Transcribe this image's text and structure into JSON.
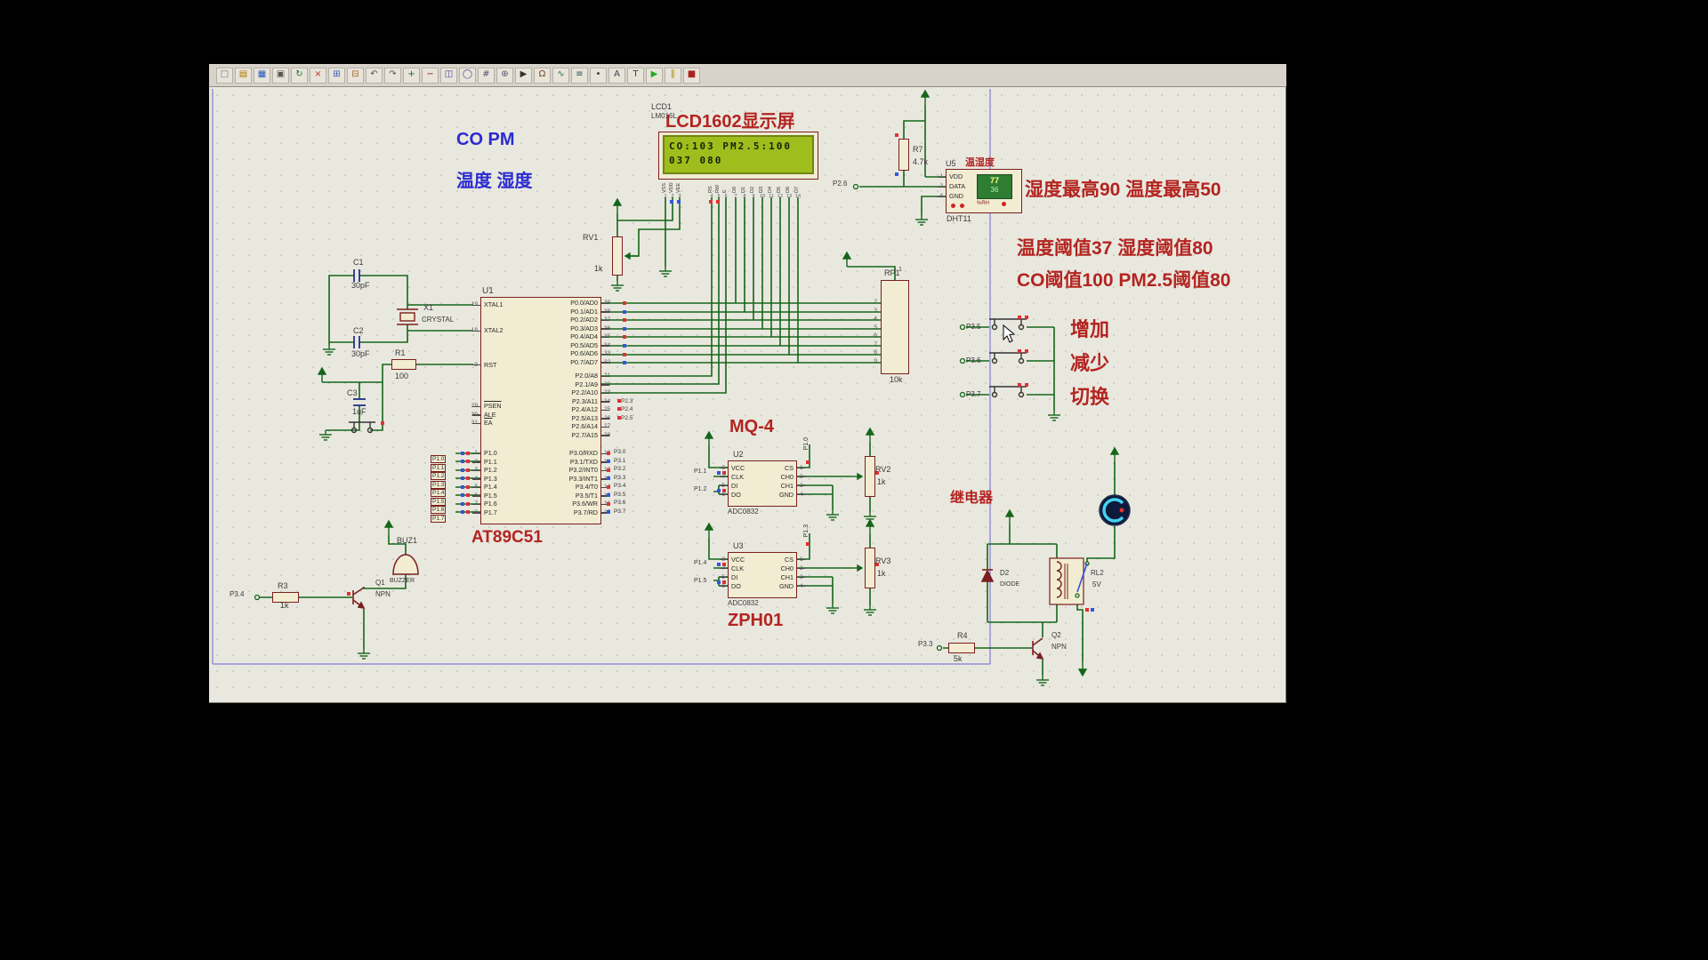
{
  "colors": {
    "wire_green": "#15651a",
    "component_outline": "#7a1f1f",
    "annotation_red": "#b32420",
    "annotation_blue": "#2b2bd0",
    "state_high_red": "#e03131",
    "state_low_blue": "#3156e0",
    "sheet_border_blue": "#5050d0",
    "lcd_screen_green": "#9fbd1c"
  },
  "toolbar": {
    "icons": [
      {
        "n": "new-sheet",
        "g": "□",
        "c": "#667788"
      },
      {
        "n": "open",
        "g": "▤",
        "c": "#aa7700"
      },
      {
        "n": "save",
        "g": "▦",
        "c": "#2255bb"
      },
      {
        "n": "print",
        "g": "▣",
        "c": "#555555"
      },
      {
        "n": "refresh",
        "g": "↻",
        "c": "#227733"
      },
      {
        "n": "cut",
        "g": "×",
        "c": "#bb3333"
      },
      {
        "n": "copy",
        "g": "⊞",
        "c": "#3355bb"
      },
      {
        "n": "paste",
        "g": "⊟",
        "c": "#996622"
      },
      {
        "n": "undo",
        "g": "↶",
        "c": "#555555"
      },
      {
        "n": "redo",
        "g": "↷",
        "c": "#555555"
      },
      {
        "n": "zoom-in",
        "g": "+",
        "c": "#226622"
      },
      {
        "n": "zoom-out",
        "g": "−",
        "c": "#882222"
      },
      {
        "n": "zoom-area",
        "g": "◫",
        "c": "#444499"
      },
      {
        "n": "zoom-all",
        "g": "◯",
        "c": "#444499"
      },
      {
        "n": "grid",
        "g": "#",
        "c": "#555577"
      },
      {
        "n": "origin",
        "g": "⊕",
        "c": "#555577"
      },
      {
        "n": "selection-cursor",
        "g": "▶",
        "c": "#333333"
      },
      {
        "n": "component-mode",
        "g": "Ω",
        "c": "#774422"
      },
      {
        "n": "wire-mode",
        "g": "∿",
        "c": "#227733"
      },
      {
        "n": "bus-mode",
        "g": "≡",
        "c": "#225555"
      },
      {
        "n": "junction",
        "g": "•",
        "c": "#333333"
      },
      {
        "n": "label",
        "g": "A",
        "c": "#334455"
      },
      {
        "n": "text",
        "g": "T",
        "c": "#334455"
      },
      {
        "n": "play",
        "g": "▶",
        "c": "#22aa22"
      },
      {
        "n": "pause",
        "g": "∥",
        "c": "#aa8800"
      },
      {
        "n": "stop",
        "g": "■",
        "c": "#aa2222"
      }
    ]
  },
  "annotations": {
    "co_pm": "CO PM",
    "temp_hum": "温度 湿度",
    "lcd_title": "LCD1602显示屏",
    "limits1": "湿度最高90 温度最高50",
    "limits2": "温度阈值37 湿度阈值80",
    "limits3": "CO阈值100 PM2.5阈值80",
    "mq4": "MQ-4",
    "zph01": "ZPH01",
    "relay": "继电器",
    "dht_label": "温湿度"
  },
  "lcd": {
    "ref": "LCD1",
    "model": "LM016L",
    "line1": "CO:103 PM2.5:100",
    "line2": "037 080",
    "pins_power": [
      {
        "name": "VSS",
        "num": "1"
      },
      {
        "name": "VDD",
        "num": "2"
      },
      {
        "name": "VEE",
        "num": "3"
      }
    ],
    "pins_ctrl": [
      {
        "name": "RS",
        "num": "4"
      },
      {
        "name": "RW",
        "num": "5"
      },
      {
        "name": "E",
        "num": "6"
      }
    ],
    "pins_data": [
      {
        "name": "D0",
        "num": "7"
      },
      {
        "name": "D1",
        "num": "8"
      },
      {
        "name": "D2",
        "num": "9"
      },
      {
        "name": "D3",
        "num": "10"
      },
      {
        "name": "D4",
        "num": "11"
      },
      {
        "name": "D5",
        "num": "12"
      },
      {
        "name": "D6",
        "num": "13"
      },
      {
        "name": "D7",
        "num": "14"
      }
    ]
  },
  "mcu": {
    "ref": "U1",
    "name": "AT89C51",
    "xtal": [
      {
        "name": "XTAL1",
        "num": "19"
      },
      {
        "name": "XTAL2",
        "num": "18"
      }
    ],
    "rst": [
      {
        "name": "RST",
        "num": "9"
      }
    ],
    "ctrl": [
      {
        "name": "PSEN",
        "num": "29",
        "state": "ov"
      },
      {
        "name": "ALE",
        "num": "30"
      },
      {
        "name": "EA",
        "num": "31",
        "state": "ov"
      }
    ],
    "p1": [
      {
        "name": "P1.0",
        "num": "1"
      },
      {
        "name": "P1.1",
        "num": "2"
      },
      {
        "name": "P1.2",
        "num": "3"
      },
      {
        "name": "P1.3",
        "num": "4"
      },
      {
        "name": "P1.4",
        "num": "5"
      },
      {
        "name": "P1.5",
        "num": "6"
      },
      {
        "name": "P1.6",
        "num": "7"
      },
      {
        "name": "P1.7",
        "num": "8"
      }
    ],
    "p0": [
      {
        "name": "P0.0/AD0",
        "num": "39"
      },
      {
        "name": "P0.1/AD1",
        "num": "38"
      },
      {
        "name": "P0.2/AD2",
        "num": "37"
      },
      {
        "name": "P0.3/AD3",
        "num": "36"
      },
      {
        "name": "P0.4/AD4",
        "num": "35"
      },
      {
        "name": "P0.5/AD5",
        "num": "34"
      },
      {
        "name": "P0.6/AD6",
        "num": "33"
      },
      {
        "name": "P0.7/AD7",
        "num": "32"
      }
    ],
    "p2": [
      {
        "name": "P2.0/A8",
        "num": "21"
      },
      {
        "name": "P2.1/A9",
        "num": "22"
      },
      {
        "name": "P2.2/A10",
        "num": "23"
      },
      {
        "name": "P2.3/A11",
        "num": "24"
      },
      {
        "name": "P2.4/A12",
        "num": "25"
      },
      {
        "name": "P2.5/A13",
        "num": "26"
      },
      {
        "name": "P2.6/A14",
        "num": "27"
      },
      {
        "name": "P2.7/A15",
        "num": "28"
      }
    ],
    "p3": [
      {
        "name": "P3.0/RXD",
        "num": "10"
      },
      {
        "name": "P3.1/TXD",
        "num": "11"
      },
      {
        "name": "P3.2/INT0",
        "num": "12"
      },
      {
        "name": "P3.3/INT1",
        "num": "13"
      },
      {
        "name": "P3.4/T0",
        "num": "14"
      },
      {
        "name": "P3.5/T1",
        "num": "15"
      },
      {
        "name": "P3.6/WR",
        "num": "16"
      },
      {
        "name": "P3.7/RD",
        "num": "17"
      }
    ]
  },
  "adc": {
    "left": [
      {
        "name": "VCC",
        "num": "8"
      },
      {
        "name": "CLK",
        "num": "7"
      },
      {
        "name": "DI",
        "num": "5"
      },
      {
        "name": "DO",
        "num": "6"
      }
    ],
    "right": [
      {
        "name": "CS",
        "num": "1"
      },
      {
        "name": "CH0",
        "num": "2"
      },
      {
        "name": "CH1",
        "num": "3"
      },
      {
        "name": "GND",
        "num": "4"
      }
    ]
  },
  "dht": {
    "pins": [
      {
        "name": "VDD",
        "num": "1"
      },
      {
        "name": "DATA",
        "num": "2"
      },
      {
        "name": "GND",
        "num": "4"
      }
    ],
    "display_top": "77",
    "display_bottom": "36",
    "rh": "%RH"
  },
  "rp1_pins": [
    "2",
    "3",
    "4",
    "5",
    "6",
    "7",
    "8",
    "9"
  ],
  "parts": {
    "c1": {
      "ref": "C1",
      "val": "30pF"
    },
    "c2": {
      "ref": "C2",
      "val": "30pF"
    },
    "c3": {
      "ref": "C3",
      "val": "1uF"
    },
    "x1": {
      "ref": "X1",
      "val": "CRYSTAL"
    },
    "r1": {
      "ref": "R1",
      "val": "100"
    },
    "r3": {
      "ref": "R3",
      "val": "1k"
    },
    "r4": {
      "ref": "R4",
      "val": "5k"
    },
    "r7": {
      "ref": "R7",
      "val": "4.7k"
    },
    "rv1": {
      "ref": "RV1",
      "val": "1k"
    },
    "rv2": {
      "ref": "RV2",
      "val": "1k"
    },
    "rv3": {
      "ref": "RV3",
      "val": "1k"
    },
    "rp1": {
      "ref": "RP1",
      "val": "10k",
      "pin1": "1"
    },
    "u2": {
      "ref": "U2",
      "val": "ADC0832"
    },
    "u3": {
      "ref": "U3",
      "val": "ADC0832"
    },
    "u5": {
      "ref": "U5",
      "val": "DHT11"
    },
    "buz1": {
      "ref": "BUZ1",
      "val": "BUZZER"
    },
    "q1": {
      "ref": "Q1",
      "val": "NPN"
    },
    "q2": {
      "ref": "Q2",
      "val": "NPN"
    },
    "d2": {
      "ref": "D2",
      "val": "DIODE"
    },
    "rl2": {
      "ref": "RL2",
      "val": "5V"
    }
  },
  "nets": {
    "p26": "P2.6",
    "p34": "P3.4",
    "p33": "P3.3",
    "p10": "P1.0",
    "p11": "P1.1",
    "p12": "P1.2",
    "p13": "P1.3",
    "p14": "P1.4",
    "p15": "P1.5",
    "p23": "P2.3",
    "p24": "P2.4",
    "p25": "P2.5"
  },
  "net_p1": [
    {
      "label": "P1.0"
    },
    {
      "label": "P1.1"
    },
    {
      "label": "P1.2"
    },
    {
      "label": "P1.3"
    },
    {
      "label": "P1.4"
    },
    {
      "label": "P1.5"
    },
    {
      "label": "P1.6"
    },
    {
      "label": "P1.7"
    }
  ],
  "net_p3": [
    {
      "label": "P3.0",
      "state": "r"
    },
    {
      "label": "P3.1",
      "state": "b"
    },
    {
      "label": "P3.2",
      "state": "r"
    },
    {
      "label": "P3.3",
      "state": "b"
    },
    {
      "label": "P3.4",
      "state": "r"
    },
    {
      "label": "P3.5",
      "state": "b"
    },
    {
      "label": "P3.6",
      "state": "r"
    },
    {
      "label": "P3.7",
      "state": "b"
    }
  ],
  "buttons": [
    {
      "net": "P3.5",
      "label": "增加"
    },
    {
      "net": "P3.6",
      "label": "减少"
    },
    {
      "net": "P3.7",
      "label": "切换"
    }
  ]
}
